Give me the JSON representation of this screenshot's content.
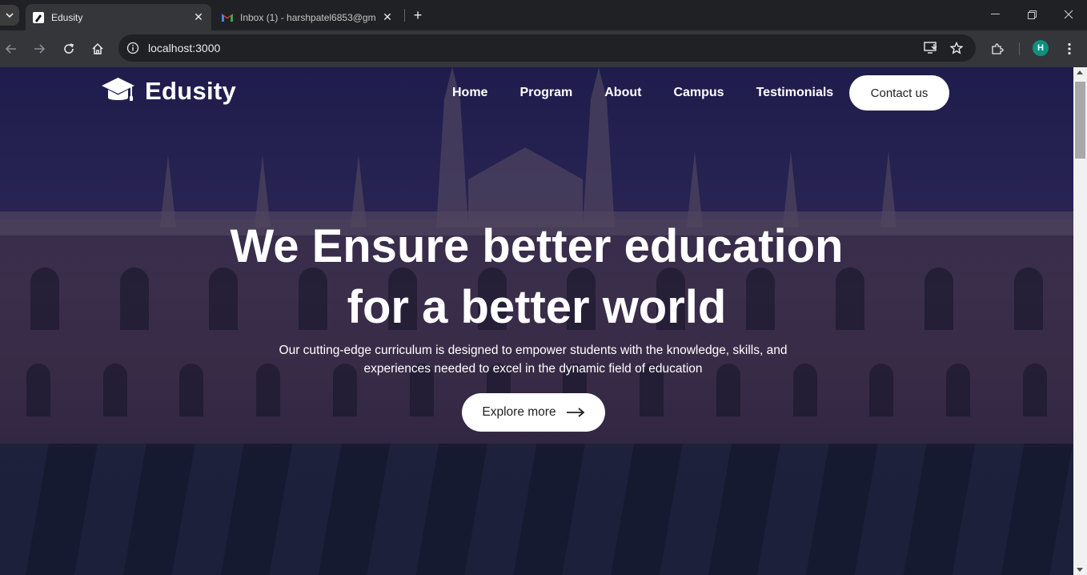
{
  "browser": {
    "tabs": [
      {
        "title": "Edusity",
        "icon": "pencil-icon",
        "active": true
      },
      {
        "title": "Inbox (1) - harshpatel6853@gm",
        "icon": "gmail-icon",
        "active": false
      }
    ],
    "address": "localhost:3000",
    "profile_initial": "H"
  },
  "site": {
    "logo_text": "Edusity",
    "nav": [
      "Home",
      "Program",
      "About",
      "Campus",
      "Testimonials"
    ],
    "contact_label": "Contact us"
  },
  "hero": {
    "title_line1": "We Ensure better education",
    "title_line2": "for a better world",
    "subtitle": "Our cutting-edge curriculum is designed to empower students with the knowledge, skills, and experiences needed to excel in the dynamic field of education",
    "cta_label": "Explore more"
  },
  "colors": {
    "overlay": "#08003a",
    "button_bg": "#ffffff",
    "profile": "#0f8f7f"
  }
}
